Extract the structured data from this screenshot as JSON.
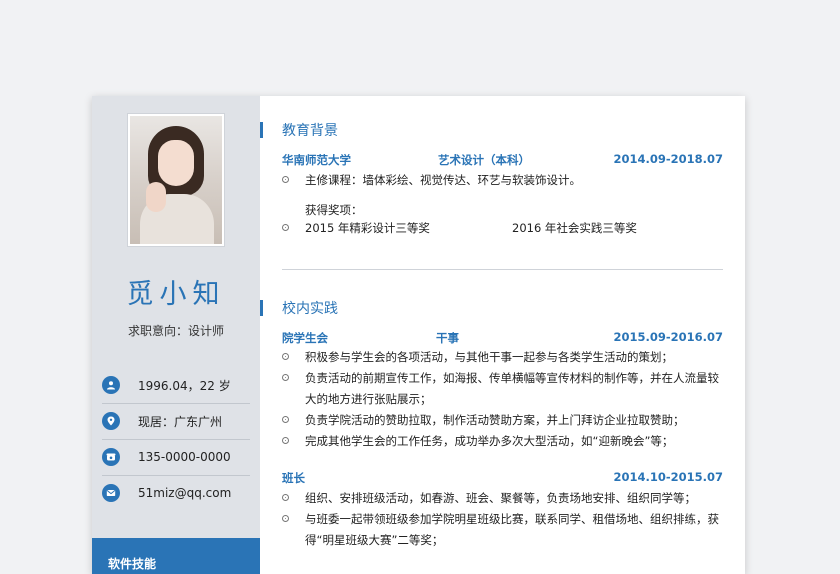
{
  "sidebar": {
    "name": "觅小知",
    "intent": "求职意向：设计师",
    "info": [
      {
        "icon": "user-icon",
        "text": "1996.04，22 岁"
      },
      {
        "icon": "location-pin-icon",
        "text": "现居：广东广州"
      },
      {
        "icon": "phone-icon",
        "text": "135-0000-0000"
      },
      {
        "icon": "mail-icon",
        "text": "51miz@qq.com"
      }
    ],
    "skills_title": "软件技能"
  },
  "education": {
    "title": "教育背景",
    "school": "华南师范大学",
    "major": "艺术设计（本科）",
    "date": "2014.09-2018.07",
    "course": "主修课程：墙体彩绘、视觉传达、环艺与软装饰设计。",
    "awards_label": "获得奖项：",
    "award1": "2015 年精彩设计三等奖",
    "award2": "2016 年社会实践三等奖"
  },
  "practice": {
    "title": "校内实践",
    "entries": [
      {
        "org": "院学生会",
        "role": "干事",
        "date": "2015.09-2016.07",
        "bullets": [
          "积极参与学生会的各项活动，与其他干事一起参与各类学生活动的策划；",
          "负责活动的前期宣传工作，如海报、传单横幅等宣传材料的制作等，并在人流量较大的地方进行张贴展示；",
          "负责学院活动的赞助拉取，制作活动赞助方案，并上门拜访企业拉取赞助；",
          "完成其他学生会的工作任务，成功举办多次大型活动，如“迎新晚会”等；"
        ]
      },
      {
        "org": "班长",
        "role": "",
        "date": "2014.10-2015.07",
        "bullets": [
          "组织、安排班级活动，如春游、班会、聚餐等，负责场地安排、组织同学等；",
          "与班委一起带领班级参加学院明星班级比赛，联系同学、租借场地、组织排练，获得“明星班级大赛”二等奖；"
        ]
      }
    ]
  },
  "colors": {
    "accent": "#2a74b6",
    "sidebar_bg": "#dfe2e7"
  }
}
